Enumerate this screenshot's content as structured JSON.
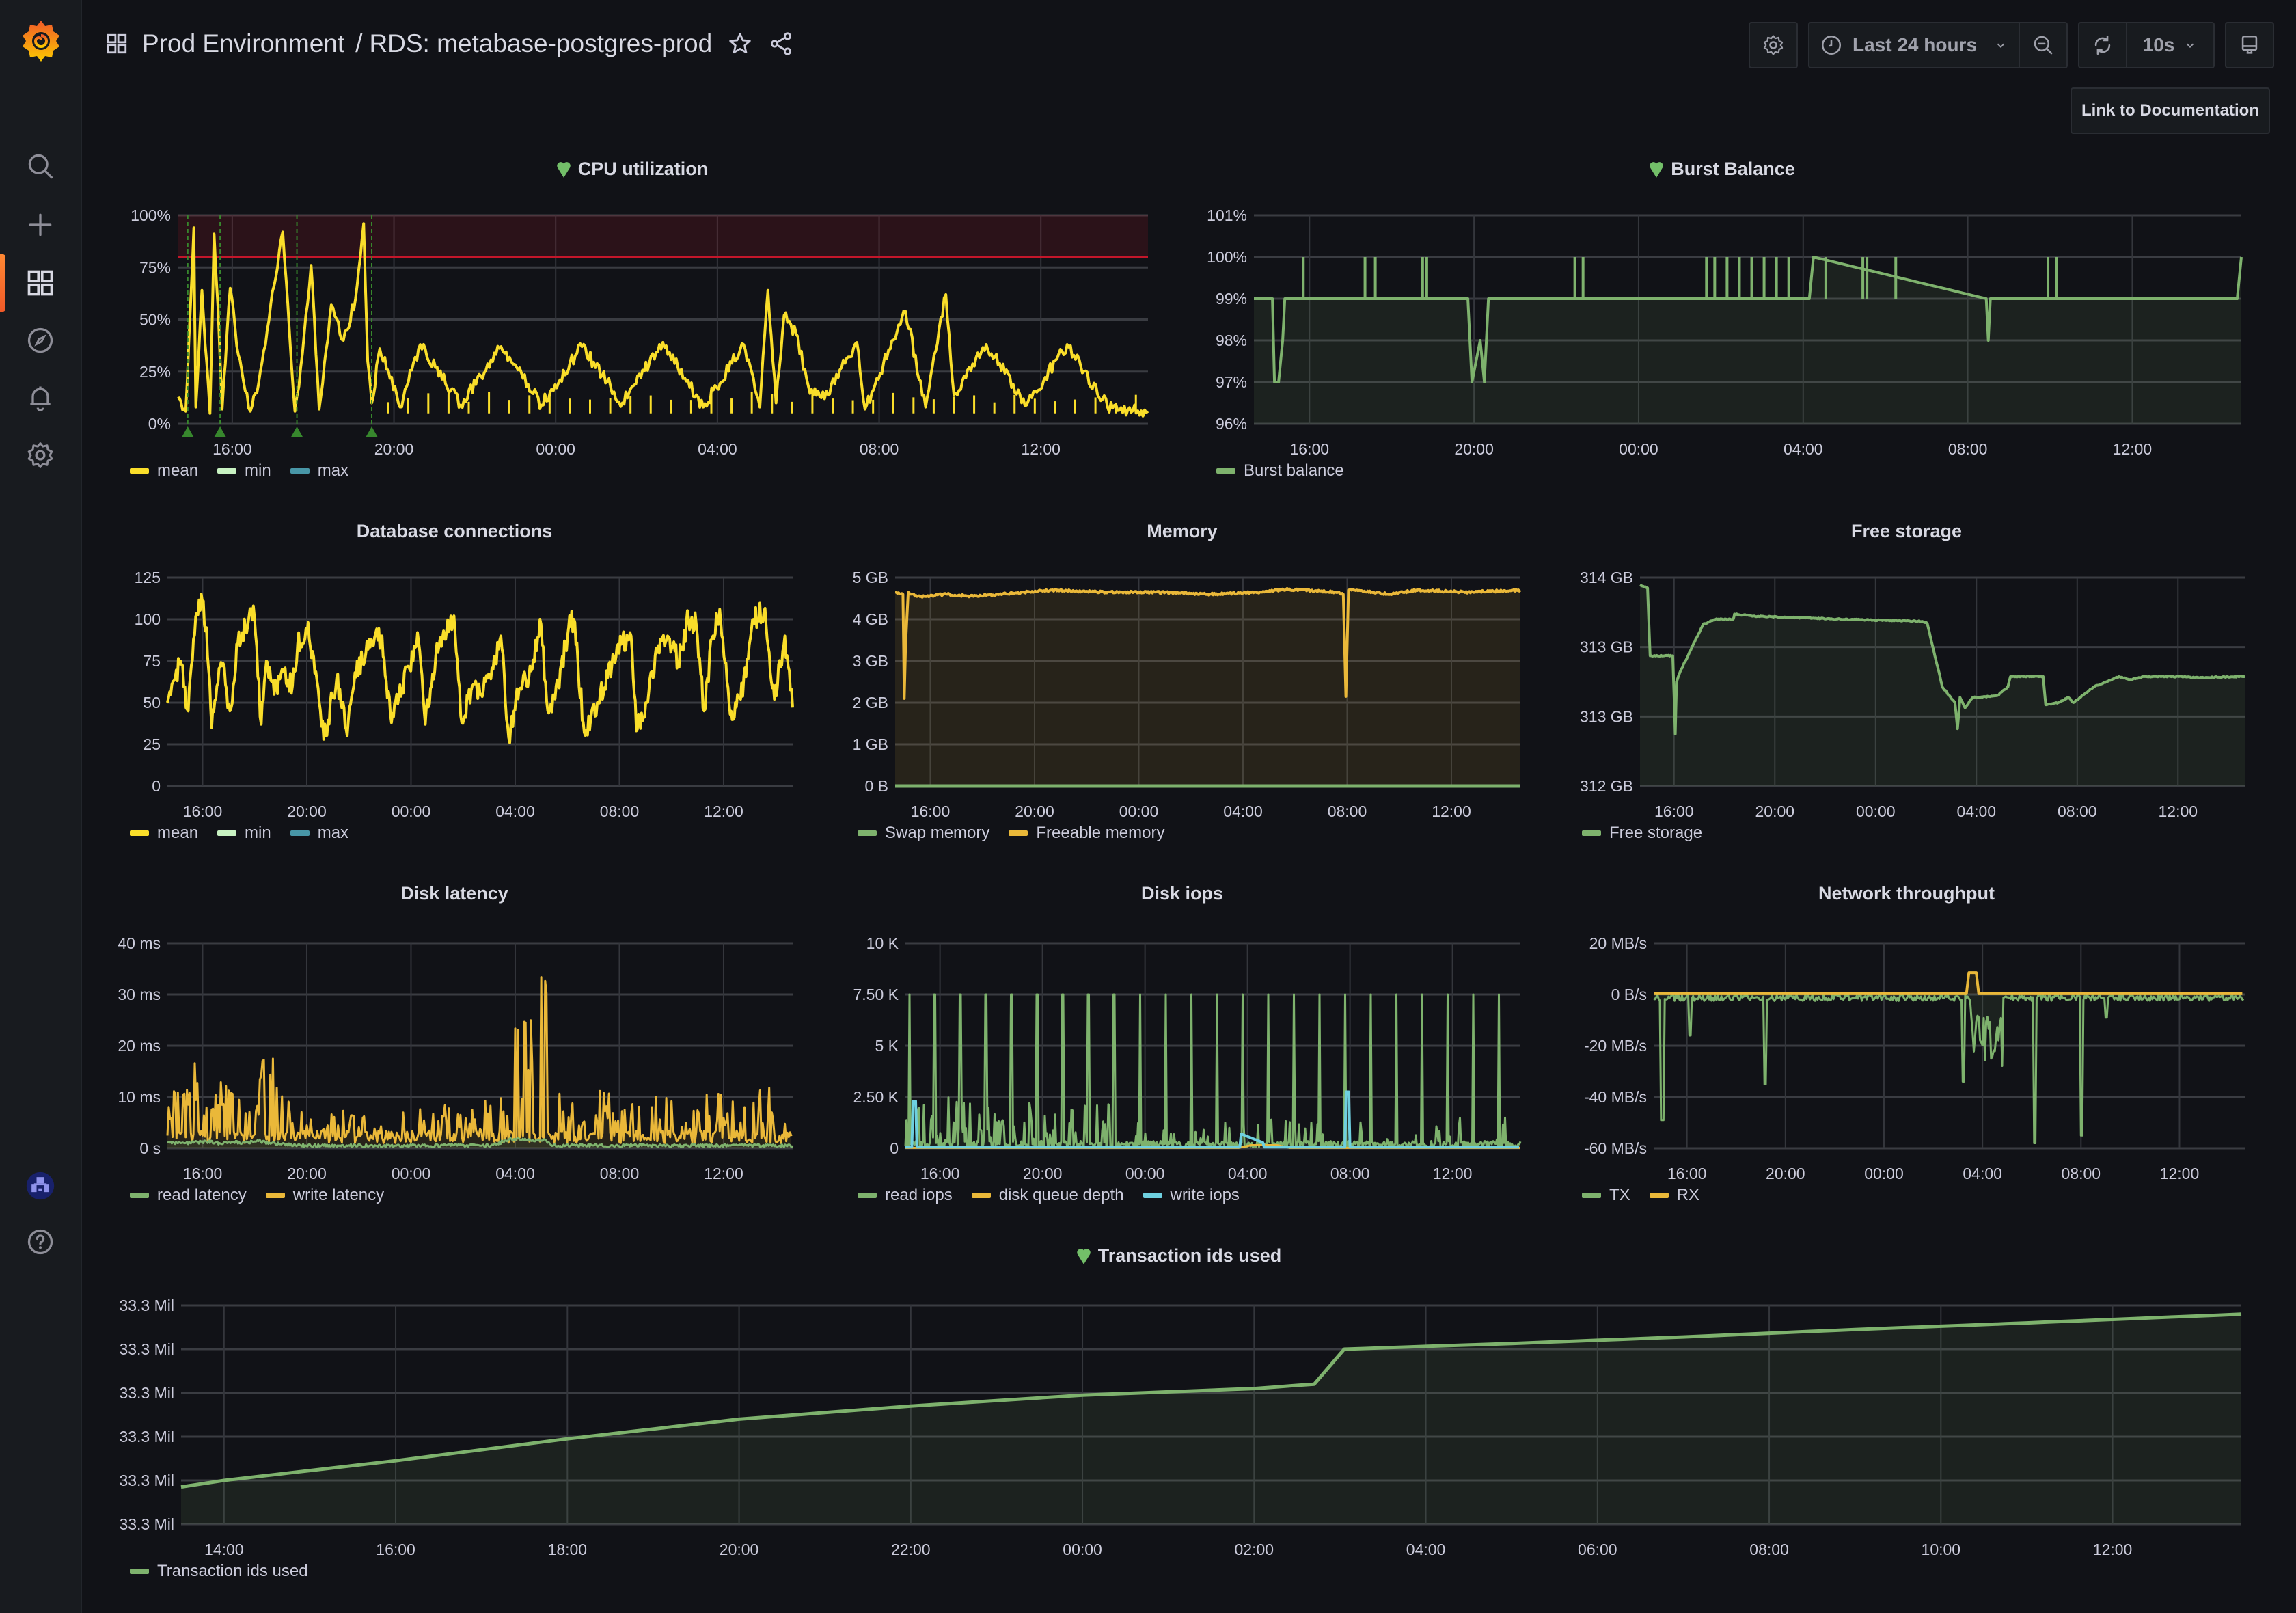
{
  "app": {
    "brand": "Grafana"
  },
  "sidebar": {
    "items": [
      {
        "name": "search",
        "label": "Search"
      },
      {
        "name": "create",
        "label": "Create"
      },
      {
        "name": "dashboards",
        "label": "Dashboards",
        "active": true
      },
      {
        "name": "explore",
        "label": "Explore"
      },
      {
        "name": "alerting",
        "label": "Alerting"
      },
      {
        "name": "configuration",
        "label": "Configuration"
      }
    ],
    "bottom": [
      {
        "name": "profile",
        "label": "Profile"
      },
      {
        "name": "help",
        "label": "Help"
      }
    ]
  },
  "header": {
    "folder": "Prod Environment",
    "separator": "/",
    "dashboard_title": "RDS: metabase-postgres-prod",
    "time_range": "Last 24 hours",
    "refresh_interval": "10s",
    "doc_link": "Link to Documentation"
  },
  "colors": {
    "yellow": "#fade2a",
    "green": "#7eb26d",
    "orange": "#eab839",
    "cyan": "#6ed0e0",
    "light_green": "#c8f2c2",
    "teal": "#4896a7",
    "threshold_red": "#c4162a",
    "health_green": "#73bf69"
  },
  "chart_data": [
    {
      "id": "cpu",
      "type": "line",
      "title": "CPU utilization",
      "health": "ok",
      "xlabel": "",
      "ylabel": "",
      "x_ticks": [
        "16:00",
        "20:00",
        "00:00",
        "04:00",
        "08:00",
        "12:00"
      ],
      "y_ticks": [
        "0%",
        "25%",
        "50%",
        "75%",
        "100%"
      ],
      "ylim": [
        0,
        100
      ],
      "threshold": 80,
      "annotations_hours_from_start": [
        0.25,
        1.05,
        2.95,
        4.8
      ],
      "x_hours": [
        0,
        0.2,
        0.4,
        0.45,
        0.6,
        0.8,
        0.9,
        1.0,
        1.1,
        1.3,
        1.5,
        1.8,
        2.0,
        2.3,
        2.6,
        2.9,
        3.0,
        3.3,
        3.5,
        3.8,
        4.1,
        4.4,
        4.6,
        4.7,
        4.8,
        5.0,
        5.5,
        6.0,
        7.0,
        8.0,
        9.0,
        10.0,
        11.0,
        12.0,
        13.0,
        14.0,
        14.4,
        14.6,
        14.8,
        15.0,
        15.3,
        15.6,
        16.0,
        16.8,
        17.0,
        18.0,
        18.5,
        19.0,
        19.2,
        20.0,
        21.0,
        22.0,
        23.0,
        24.0
      ],
      "series": [
        {
          "name": "mean",
          "values": [
            12,
            6,
            94,
            8,
            64,
            5,
            91,
            55,
            7,
            65,
            33,
            6,
            19,
            57,
            92,
            6,
            18,
            76,
            7,
            57,
            40,
            60,
            96,
            30,
            10,
            36,
            8,
            38,
            9,
            37,
            9,
            37,
            10,
            39,
            8,
            38,
            8,
            64,
            10,
            52,
            43,
            18,
            12,
            39,
            7,
            54,
            8,
            62,
            14,
            38,
            9,
            38,
            8,
            6
          ]
        },
        {
          "name": "min",
          "values": []
        },
        {
          "name": "max",
          "values": []
        }
      ],
      "legend": [
        "mean",
        "min",
        "max"
      ]
    },
    {
      "id": "burst",
      "type": "area",
      "title": "Burst Balance",
      "health": "ok",
      "x_ticks": [
        "16:00",
        "20:00",
        "00:00",
        "04:00",
        "08:00",
        "12:00"
      ],
      "y_ticks": [
        "96%",
        "97%",
        "98%",
        "99%",
        "100%",
        "101%"
      ],
      "ylim": [
        96,
        101
      ],
      "x_hours": [
        0,
        0.45,
        0.5,
        0.6,
        0.7,
        0.75,
        5.2,
        5.3,
        5.5,
        5.6,
        5.7,
        11.0,
        13.5,
        13.6,
        17.8,
        17.85,
        17.9,
        23.9,
        24.0
      ],
      "series": [
        {
          "name": "Burst balance",
          "values": [
            99,
            99,
            97,
            97,
            98,
            99,
            99,
            97,
            98,
            97,
            99,
            99,
            99,
            100,
            99,
            98,
            99,
            99,
            100
          ]
        }
      ],
      "spikes_to_100_hours": [
        1.2,
        2.7,
        2.95,
        4.1,
        4.2,
        7.8,
        8.0,
        11.0,
        11.2,
        11.5,
        11.8,
        12.1,
        12.4,
        12.7,
        13.0,
        13.9,
        14.8,
        14.9,
        15.6,
        19.3,
        19.5
      ],
      "legend": [
        "Burst balance"
      ]
    },
    {
      "id": "connections",
      "type": "line",
      "title": "Database connections",
      "x_ticks": [
        "16:00",
        "20:00",
        "00:00",
        "04:00",
        "08:00",
        "12:00"
      ],
      "y_ticks": [
        "0",
        "25",
        "50",
        "75",
        "100",
        "125"
      ],
      "ylim": [
        0,
        125
      ],
      "x_hours": [
        0,
        0.3,
        0.5,
        0.8,
        1.0,
        1.3,
        1.5,
        1.7,
        1.9,
        2.1,
        2.4,
        2.7,
        3.0,
        3.3,
        3.6,
        3.8,
        4.1,
        4.4,
        4.8,
        5.0,
        5.4,
        6.0,
        6.5,
        6.9,
        7.2,
        7.7,
        8.2,
        8.6,
        8.8,
        9.3,
        9.6,
        9.9,
        10.3,
        10.6,
        11.0,
        11.3,
        11.7,
        12.0,
        12.5,
        12.8,
        13.1,
        13.5,
        14.0,
        14.3,
        14.6,
        15.0,
        15.4,
        15.6,
        16.0,
        16.5,
        16.9,
        17.3,
        17.8,
        18.0,
        18.4,
        18.8,
        19.2,
        19.6,
        20.0,
        20.3,
        20.6,
        20.9,
        21.2,
        21.6,
        22.0,
        22.5,
        22.9,
        23.3,
        23.7,
        24.0
      ],
      "series": [
        {
          "name": "mean",
          "values": [
            50,
            65,
            75,
            45,
            88,
            115,
            95,
            35,
            60,
            72,
            45,
            85,
            95,
            108,
            37,
            75,
            55,
            70,
            60,
            85,
            98,
            28,
            65,
            30,
            68,
            82,
            90,
            38,
            55,
            70,
            92,
            37,
            78,
            93,
            102,
            38,
            60,
            55,
            70,
            90,
            29,
            58,
            70,
            100,
            45,
            60,
            95,
            100,
            32,
            50,
            65,
            85,
            90,
            33,
            50,
            80,
            90,
            75,
            101,
            97,
            45,
            88,
            106,
            43,
            52,
            100,
            105,
            52,
            90,
            47
          ]
        },
        {
          "name": "min",
          "values": []
        },
        {
          "name": "max",
          "values": []
        }
      ],
      "legend": [
        "mean",
        "min",
        "max"
      ]
    },
    {
      "id": "memory",
      "type": "area",
      "title": "Memory",
      "x_ticks": [
        "16:00",
        "20:00",
        "00:00",
        "04:00",
        "08:00",
        "12:00"
      ],
      "y_ticks": [
        "0 B",
        "1 GB",
        "2 GB",
        "3 GB",
        "4 GB",
        "5 GB"
      ],
      "ylim": [
        0,
        5
      ],
      "x_hours": [
        0,
        0.3,
        0.35,
        0.4,
        0.5,
        0.6,
        1.0,
        2.0,
        3.0,
        4.0,
        6.0,
        8.0,
        10.0,
        12.0,
        14.0,
        15.0,
        17.0,
        17.2,
        17.3,
        17.4,
        17.6,
        19.0,
        20.0,
        22.0,
        24.0
      ],
      "series": [
        {
          "name": "Swap memory",
          "values": [
            0,
            0,
            0,
            0,
            0,
            0,
            0,
            0,
            0,
            0,
            0,
            0,
            0,
            0,
            0,
            0,
            0,
            0,
            0,
            0,
            0,
            0,
            0,
            0,
            0
          ]
        },
        {
          "name": "Freeable memory",
          "values": [
            4.65,
            4.6,
            2.1,
            3.4,
            4.65,
            4.6,
            4.55,
            4.6,
            4.55,
            4.6,
            4.7,
            4.65,
            4.65,
            4.6,
            4.65,
            4.72,
            4.65,
            4.6,
            2.15,
            4.7,
            4.7,
            4.6,
            4.7,
            4.65,
            4.7
          ]
        }
      ],
      "legend": [
        "Swap memory",
        "Freeable memory"
      ]
    },
    {
      "id": "storage",
      "type": "area",
      "title": "Free storage",
      "x_ticks": [
        "16:00",
        "20:00",
        "00:00",
        "04:00",
        "08:00",
        "12:00"
      ],
      "y_ticks": [
        "312 GB",
        "313 GB",
        "313 GB",
        "314 GB"
      ],
      "ylim": [
        312,
        314
      ],
      "x_hours": [
        0,
        0.3,
        0.4,
        0.45,
        1.3,
        1.4,
        1.45,
        1.6,
        2.5,
        3.0,
        3.7,
        3.75,
        4.5,
        8.0,
        11.2,
        11.4,
        12.0,
        12.5,
        12.6,
        12.7,
        12.9,
        13.2,
        13.5,
        14.2,
        14.6,
        14.7,
        15.0,
        16.0,
        16.1,
        16.6,
        17.0,
        17.2,
        18.0,
        19.0,
        19.5,
        20.0,
        21.5,
        22.0,
        23.9,
        24.0
      ],
      "series": [
        {
          "name": "Free storage",
          "values": [
            313.93,
            313.9,
            313.25,
            313.25,
            313.25,
            312.5,
            313.0,
            313.1,
            313.55,
            313.6,
            313.6,
            313.65,
            313.63,
            313.6,
            313.58,
            313.56,
            312.95,
            312.8,
            312.55,
            312.85,
            312.75,
            312.85,
            312.85,
            312.87,
            312.95,
            313.05,
            313.05,
            313.05,
            312.78,
            312.8,
            312.85,
            312.8,
            312.95,
            313.05,
            313.02,
            313.05,
            313.05,
            313.04,
            313.05,
            313.05
          ]
        }
      ],
      "legend": [
        "Free storage"
      ]
    },
    {
      "id": "latency",
      "type": "area",
      "title": "Disk latency",
      "x_ticks": [
        "16:00",
        "20:00",
        "00:00",
        "04:00",
        "08:00",
        "12:00"
      ],
      "y_ticks": [
        "0 s",
        "10 ms",
        "20 ms",
        "30 ms",
        "40 ms"
      ],
      "ylim": [
        0,
        40
      ],
      "x_hours": [
        0,
        0.5,
        1.0,
        1.5,
        2.0,
        2.5,
        3.0,
        3.5,
        4.0,
        4.5,
        5.0,
        5.5,
        6.0,
        7.0,
        8.0,
        9.0,
        10.0,
        11.0,
        12.0,
        12.5,
        13.0,
        13.3,
        13.6,
        13.9,
        14.2,
        14.5,
        14.8,
        15.0,
        16.0,
        17.0,
        18.0,
        19.0,
        20.0,
        21.0,
        22.0,
        23.0,
        23.5,
        24.0
      ],
      "series": [
        {
          "name": "read latency",
          "values": [
            1.2,
            1.0,
            1.1,
            1.3,
            1.0,
            1.2,
            1.1,
            1.4,
            1.0,
            0.8,
            0.6,
            0.5,
            0.5,
            0.5,
            0.5,
            0.5,
            0.5,
            0.6,
            0.5,
            0.6,
            1.5,
            1.8,
            1.6,
            1.5,
            1.6,
            1.7,
            0.5,
            0.5,
            0.6,
            0.5,
            0.6,
            0.5,
            0.5,
            0.5,
            0.6,
            0.5,
            0.5,
            0.5
          ]
        },
        {
          "name": "write latency",
          "values": [
            11,
            13,
            20,
            12,
            13,
            12,
            11,
            16,
            20,
            13,
            10,
            8,
            6,
            8,
            7,
            9,
            8,
            9,
            7,
            15,
            8,
            28,
            24,
            37,
            30,
            39,
            6,
            14,
            8,
            14,
            10,
            11,
            7,
            12,
            10,
            12,
            13,
            2
          ]
        }
      ],
      "legend": [
        "read latency",
        "write latency"
      ]
    },
    {
      "id": "iops",
      "type": "line",
      "title": "Disk iops",
      "x_ticks": [
        "16:00",
        "20:00",
        "00:00",
        "04:00",
        "08:00",
        "12:00"
      ],
      "y_ticks": [
        "0",
        "2.50 K",
        "5 K",
        "7.50 K",
        "10 K"
      ],
      "ylim": [
        0,
        10000
      ],
      "read_spike_peak": 7600,
      "read_spike_every_hours": 1,
      "series": [
        {
          "name": "read iops",
          "max": 8800
        },
        {
          "name": "disk queue depth",
          "max": 200
        },
        {
          "name": "write iops",
          "max": 2800
        }
      ],
      "legend": [
        "read iops",
        "disk queue depth",
        "write iops"
      ]
    },
    {
      "id": "network",
      "type": "area",
      "title": "Network throughput",
      "x_ticks": [
        "16:00",
        "20:00",
        "00:00",
        "04:00",
        "08:00",
        "12:00"
      ],
      "y_ticks": [
        "-60 MB/s",
        "-40 MB/s",
        "-20 MB/s",
        "0 B/s",
        "20 MB/s"
      ],
      "ylim": [
        -60,
        20
      ],
      "tx_dips": [
        {
          "h": 0.35,
          "v": -49
        },
        {
          "h": 1.5,
          "v": -16
        },
        {
          "h": 4.5,
          "v": -35
        },
        {
          "h": 12.6,
          "v": -34
        },
        {
          "h": 12.95,
          "v": -47
        },
        {
          "h": 13.5,
          "v": -23
        },
        {
          "h": 15.5,
          "v": -58
        },
        {
          "h": 17.4,
          "v": -55
        },
        {
          "h": 18.4,
          "v": -9
        }
      ],
      "rx_peak": {
        "h": 12.9,
        "v": 8.5
      },
      "series": [
        {
          "name": "TX"
        },
        {
          "name": "RX"
        }
      ],
      "legend": [
        "TX",
        "RX"
      ]
    },
    {
      "id": "txids",
      "type": "area",
      "title": "Transaction ids used",
      "health": "ok",
      "x_ticks": [
        "14:00",
        "16:00",
        "18:00",
        "20:00",
        "22:00",
        "00:00",
        "02:00",
        "04:00",
        "06:00",
        "08:00",
        "10:00",
        "12:00"
      ],
      "y_ticks": [
        "33.3 Mil",
        "33.3 Mil",
        "33.3 Mil",
        "33.3 Mil",
        "33.3 Mil",
        "33.3 Mil"
      ],
      "ylim": [
        0,
        5
      ],
      "x_hours": [
        0,
        0.5,
        2.5,
        4.5,
        6.5,
        8.5,
        10.5,
        12.5,
        13.2,
        13.55,
        15.5,
        17.5,
        19.5,
        21.5,
        23.5,
        24.0
      ],
      "series": [
        {
          "name": "Transaction ids used",
          "values": [
            0.85,
            1.0,
            1.45,
            1.95,
            2.4,
            2.7,
            2.95,
            3.1,
            3.2,
            4.0,
            4.13,
            4.28,
            4.45,
            4.6,
            4.76,
            4.8
          ]
        }
      ],
      "legend": [
        "Transaction ids used"
      ]
    }
  ]
}
